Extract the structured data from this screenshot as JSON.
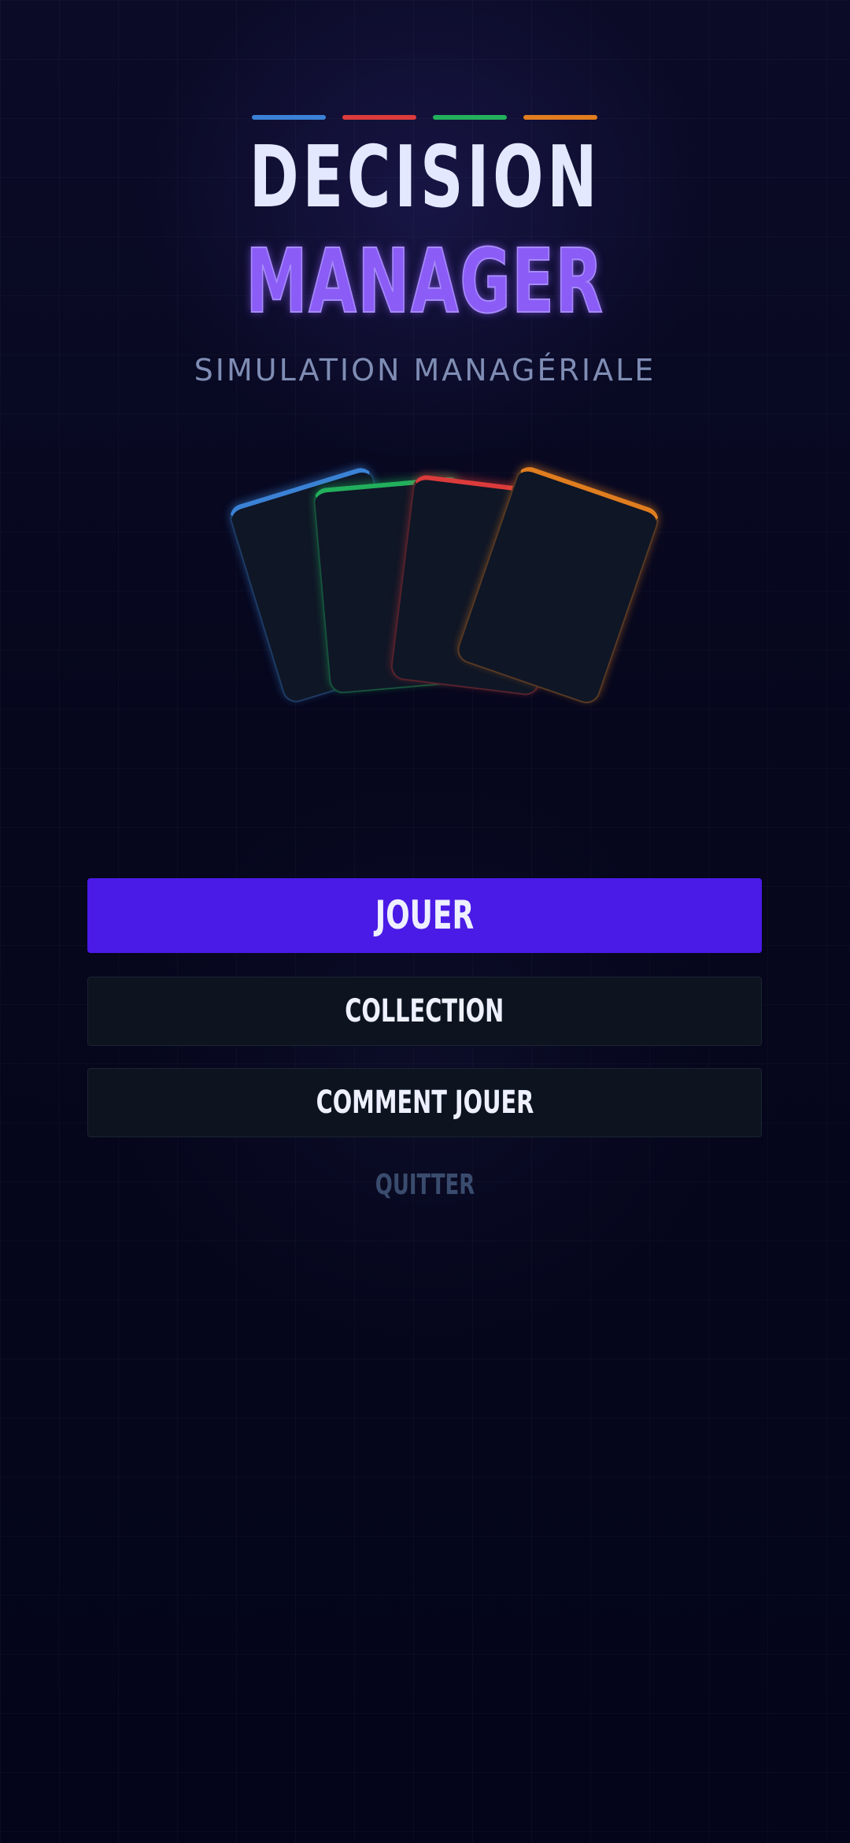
{
  "header": {
    "title_line_1": "DECISION",
    "title_line_2": "MANAGER",
    "subtitle": "SIMULATION MANAGÉRIALE",
    "accent_colors": [
      "#3b82d6",
      "#dc3b3b",
      "#22b05c",
      "#e07d1f"
    ]
  },
  "cards": {
    "colors": [
      "#3b82d6",
      "#22b05c",
      "#dc3b3b",
      "#e07d1f"
    ]
  },
  "menu": {
    "play_label": "JOUER",
    "collection_label": "COLLECTION",
    "how_to_play_label": "COMMENT JOUER",
    "quit_label": "QUITTER"
  },
  "colors": {
    "background": "#05061b",
    "primary_button": "#4a1ae6",
    "secondary_button": "#0d141f",
    "title_accent": "#8b5cf6"
  }
}
